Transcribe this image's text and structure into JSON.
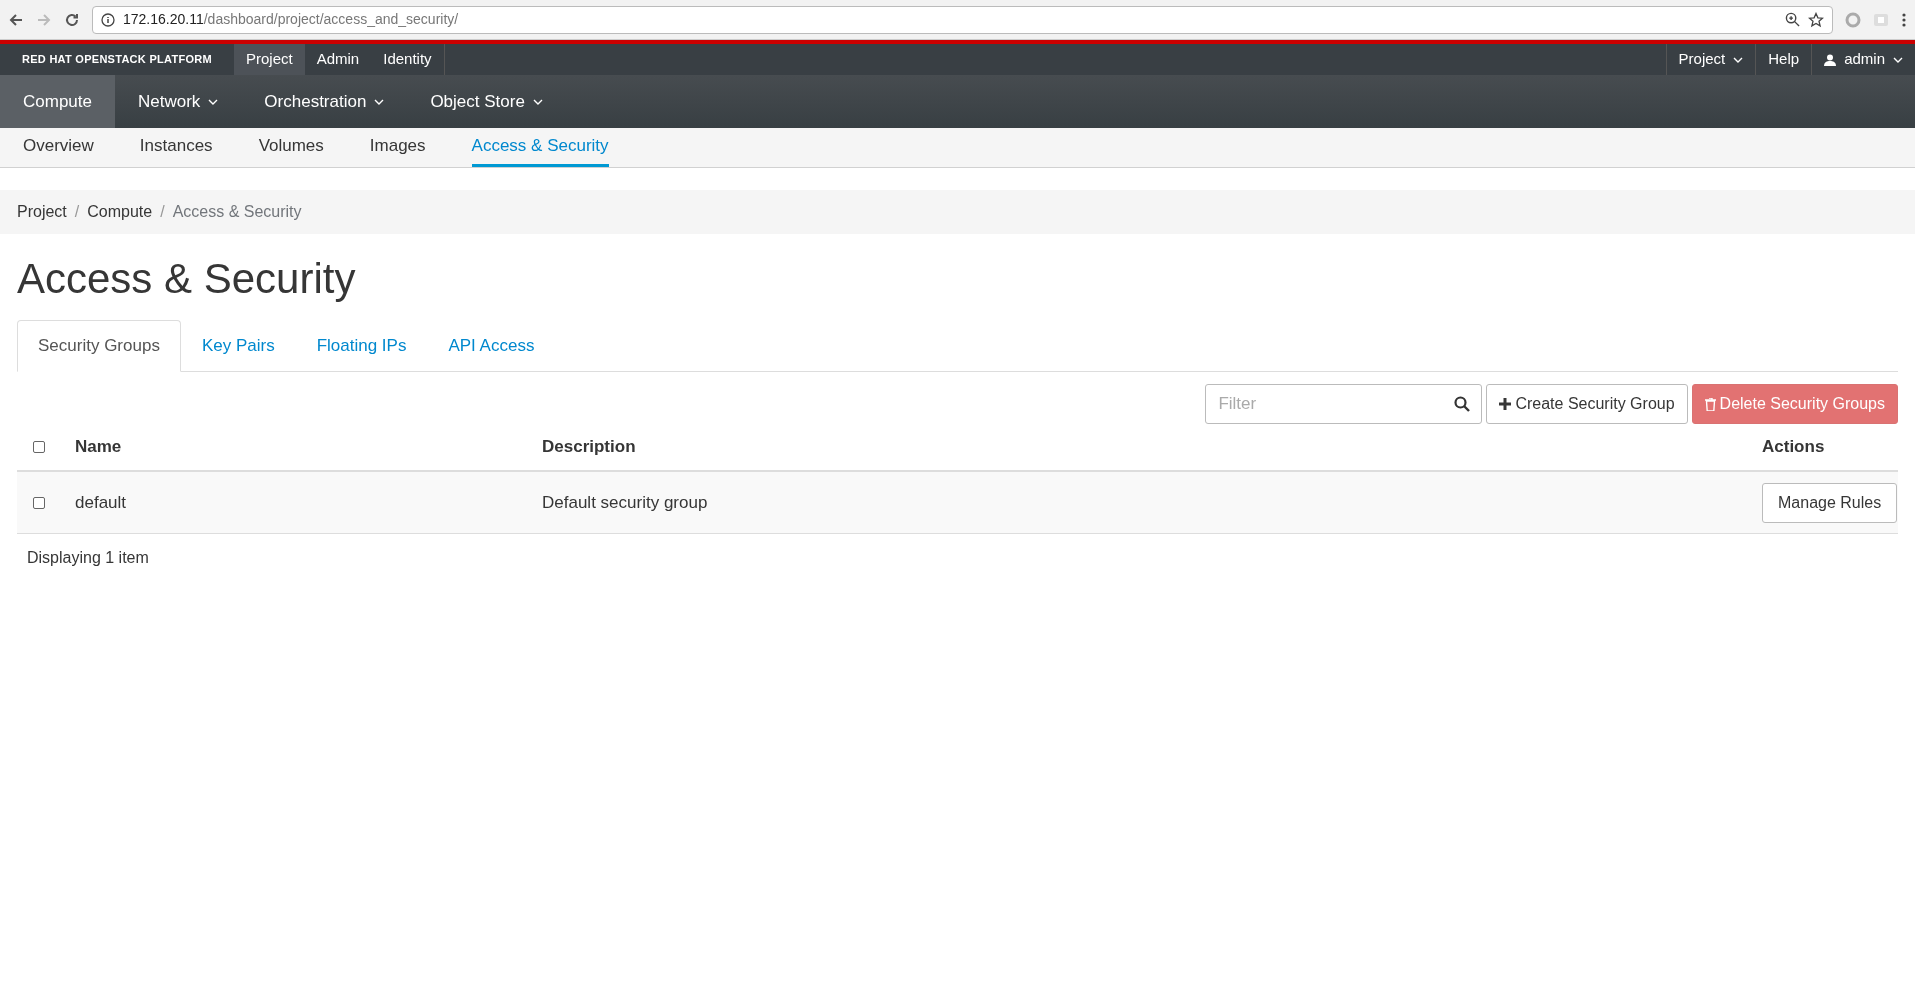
{
  "browser": {
    "url_host": "172.16.20.11",
    "url_path": "/dashboard/project/access_and_security/"
  },
  "brand": "RED HAT OPENSTACK PLATFORM",
  "top_nav": [
    {
      "label": "Project",
      "selected": true
    },
    {
      "label": "Admin",
      "selected": false
    },
    {
      "label": "Identity",
      "selected": false
    }
  ],
  "top_right": [
    {
      "label": "Project",
      "kind": "dropdown"
    },
    {
      "label": "Help",
      "kind": "link"
    },
    {
      "label": "admin",
      "kind": "user"
    }
  ],
  "section_nav": [
    {
      "label": "Compute",
      "selected": true,
      "dropdown": false
    },
    {
      "label": "Network",
      "selected": false,
      "dropdown": true
    },
    {
      "label": "Orchestration",
      "selected": false,
      "dropdown": true
    },
    {
      "label": "Object Store",
      "selected": false,
      "dropdown": true
    }
  ],
  "sub_nav": [
    {
      "label": "Overview",
      "selected": false
    },
    {
      "label": "Instances",
      "selected": false
    },
    {
      "label": "Volumes",
      "selected": false
    },
    {
      "label": "Images",
      "selected": false
    },
    {
      "label": "Access & Security",
      "selected": true
    }
  ],
  "breadcrumb": [
    {
      "label": "Project",
      "separator": "/"
    },
    {
      "label": "Compute",
      "separator": "/"
    },
    {
      "label": "Access & Security"
    }
  ],
  "page_title": "Access & Security",
  "tabs": [
    {
      "label": "Security Groups",
      "selected": true
    },
    {
      "label": "Key Pairs",
      "selected": false
    },
    {
      "label": "Floating IPs",
      "selected": false
    },
    {
      "label": "API Access",
      "selected": false
    }
  ],
  "filter": {
    "placeholder": "Filter"
  },
  "actions": [
    {
      "label": "Create Security Group",
      "kind": "create",
      "disabled": false
    },
    {
      "label": "Delete Security Groups",
      "kind": "delete",
      "disabled": true
    }
  ],
  "table": {
    "select_all_checked": false,
    "columns": [
      "Name",
      "Description",
      "Actions"
    ],
    "rows": [
      {
        "checked": false,
        "name": "default",
        "description": "Default security group",
        "action": "Manage Rules"
      }
    ],
    "footer": "Displaying 1 item"
  }
}
